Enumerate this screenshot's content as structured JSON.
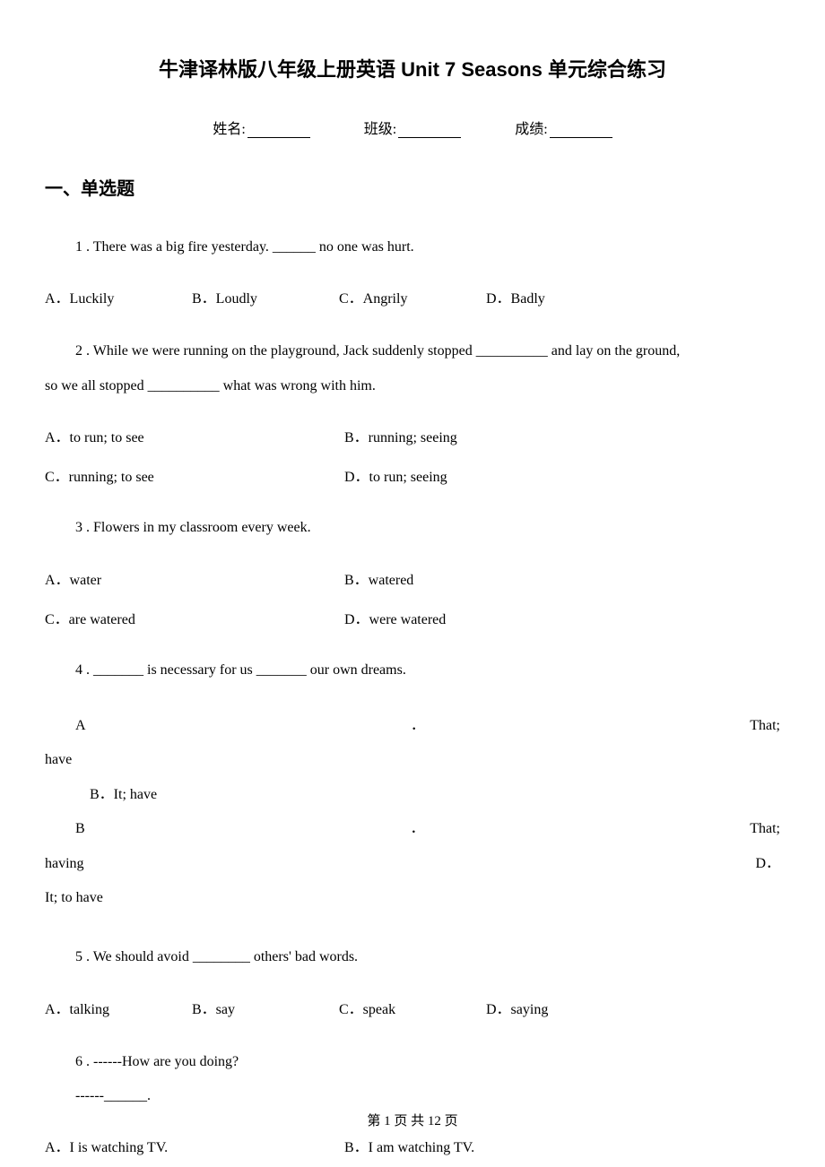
{
  "title": "牛津译林版八年级上册英语 Unit 7 Seasons 单元综合练习",
  "info": {
    "name_label": "姓名:",
    "class_label": "班级:",
    "score_label": "成绩:"
  },
  "section1": "一、单选题",
  "q1": {
    "text": "1 . There was a big fire yesterday. ______ no one was hurt.",
    "A": "A．Luckily",
    "B": "B．Loudly",
    "C": "C．Angrily",
    "D": "D．Badly"
  },
  "q2": {
    "line1": "2 . While we were running on the playground, Jack suddenly stopped __________ and lay on the ground,",
    "line2": "so we all stopped __________ what was wrong with him.",
    "A": "A．to run; to see",
    "B": "B．running; seeing",
    "C": "C．running; to see",
    "D": "D．to run; seeing"
  },
  "q3": {
    "text": "3 . Flowers in my classroom            every week.",
    "A": "A．water",
    "B": "B．watered",
    "C": "C．are watered",
    "D": "D．were watered"
  },
  "q4": {
    "text": "4 . _______ is necessary for us _______ our own dreams.",
    "A_left": "A",
    "A_dot": "．",
    "A_right": "That;",
    "have": "have",
    "B_line": "B．It; have",
    "B2_left": "B",
    "B2_dot": "．",
    "B2_right": "That;",
    "having_left": "having",
    "having_right": "D．",
    "D_line": "It; to have"
  },
  "q5": {
    "text": "5 . We should avoid ________ others' bad words.",
    "A": "A．talking",
    "B": "B．say",
    "C": "C．speak",
    "D": "D．saying"
  },
  "q6": {
    "line1": "6 . ------How are you doing?",
    "line2": "------______.",
    "A": "A．I is watching TV.",
    "B": "B．I am watching TV."
  },
  "footer": "第 1 页 共 12 页"
}
